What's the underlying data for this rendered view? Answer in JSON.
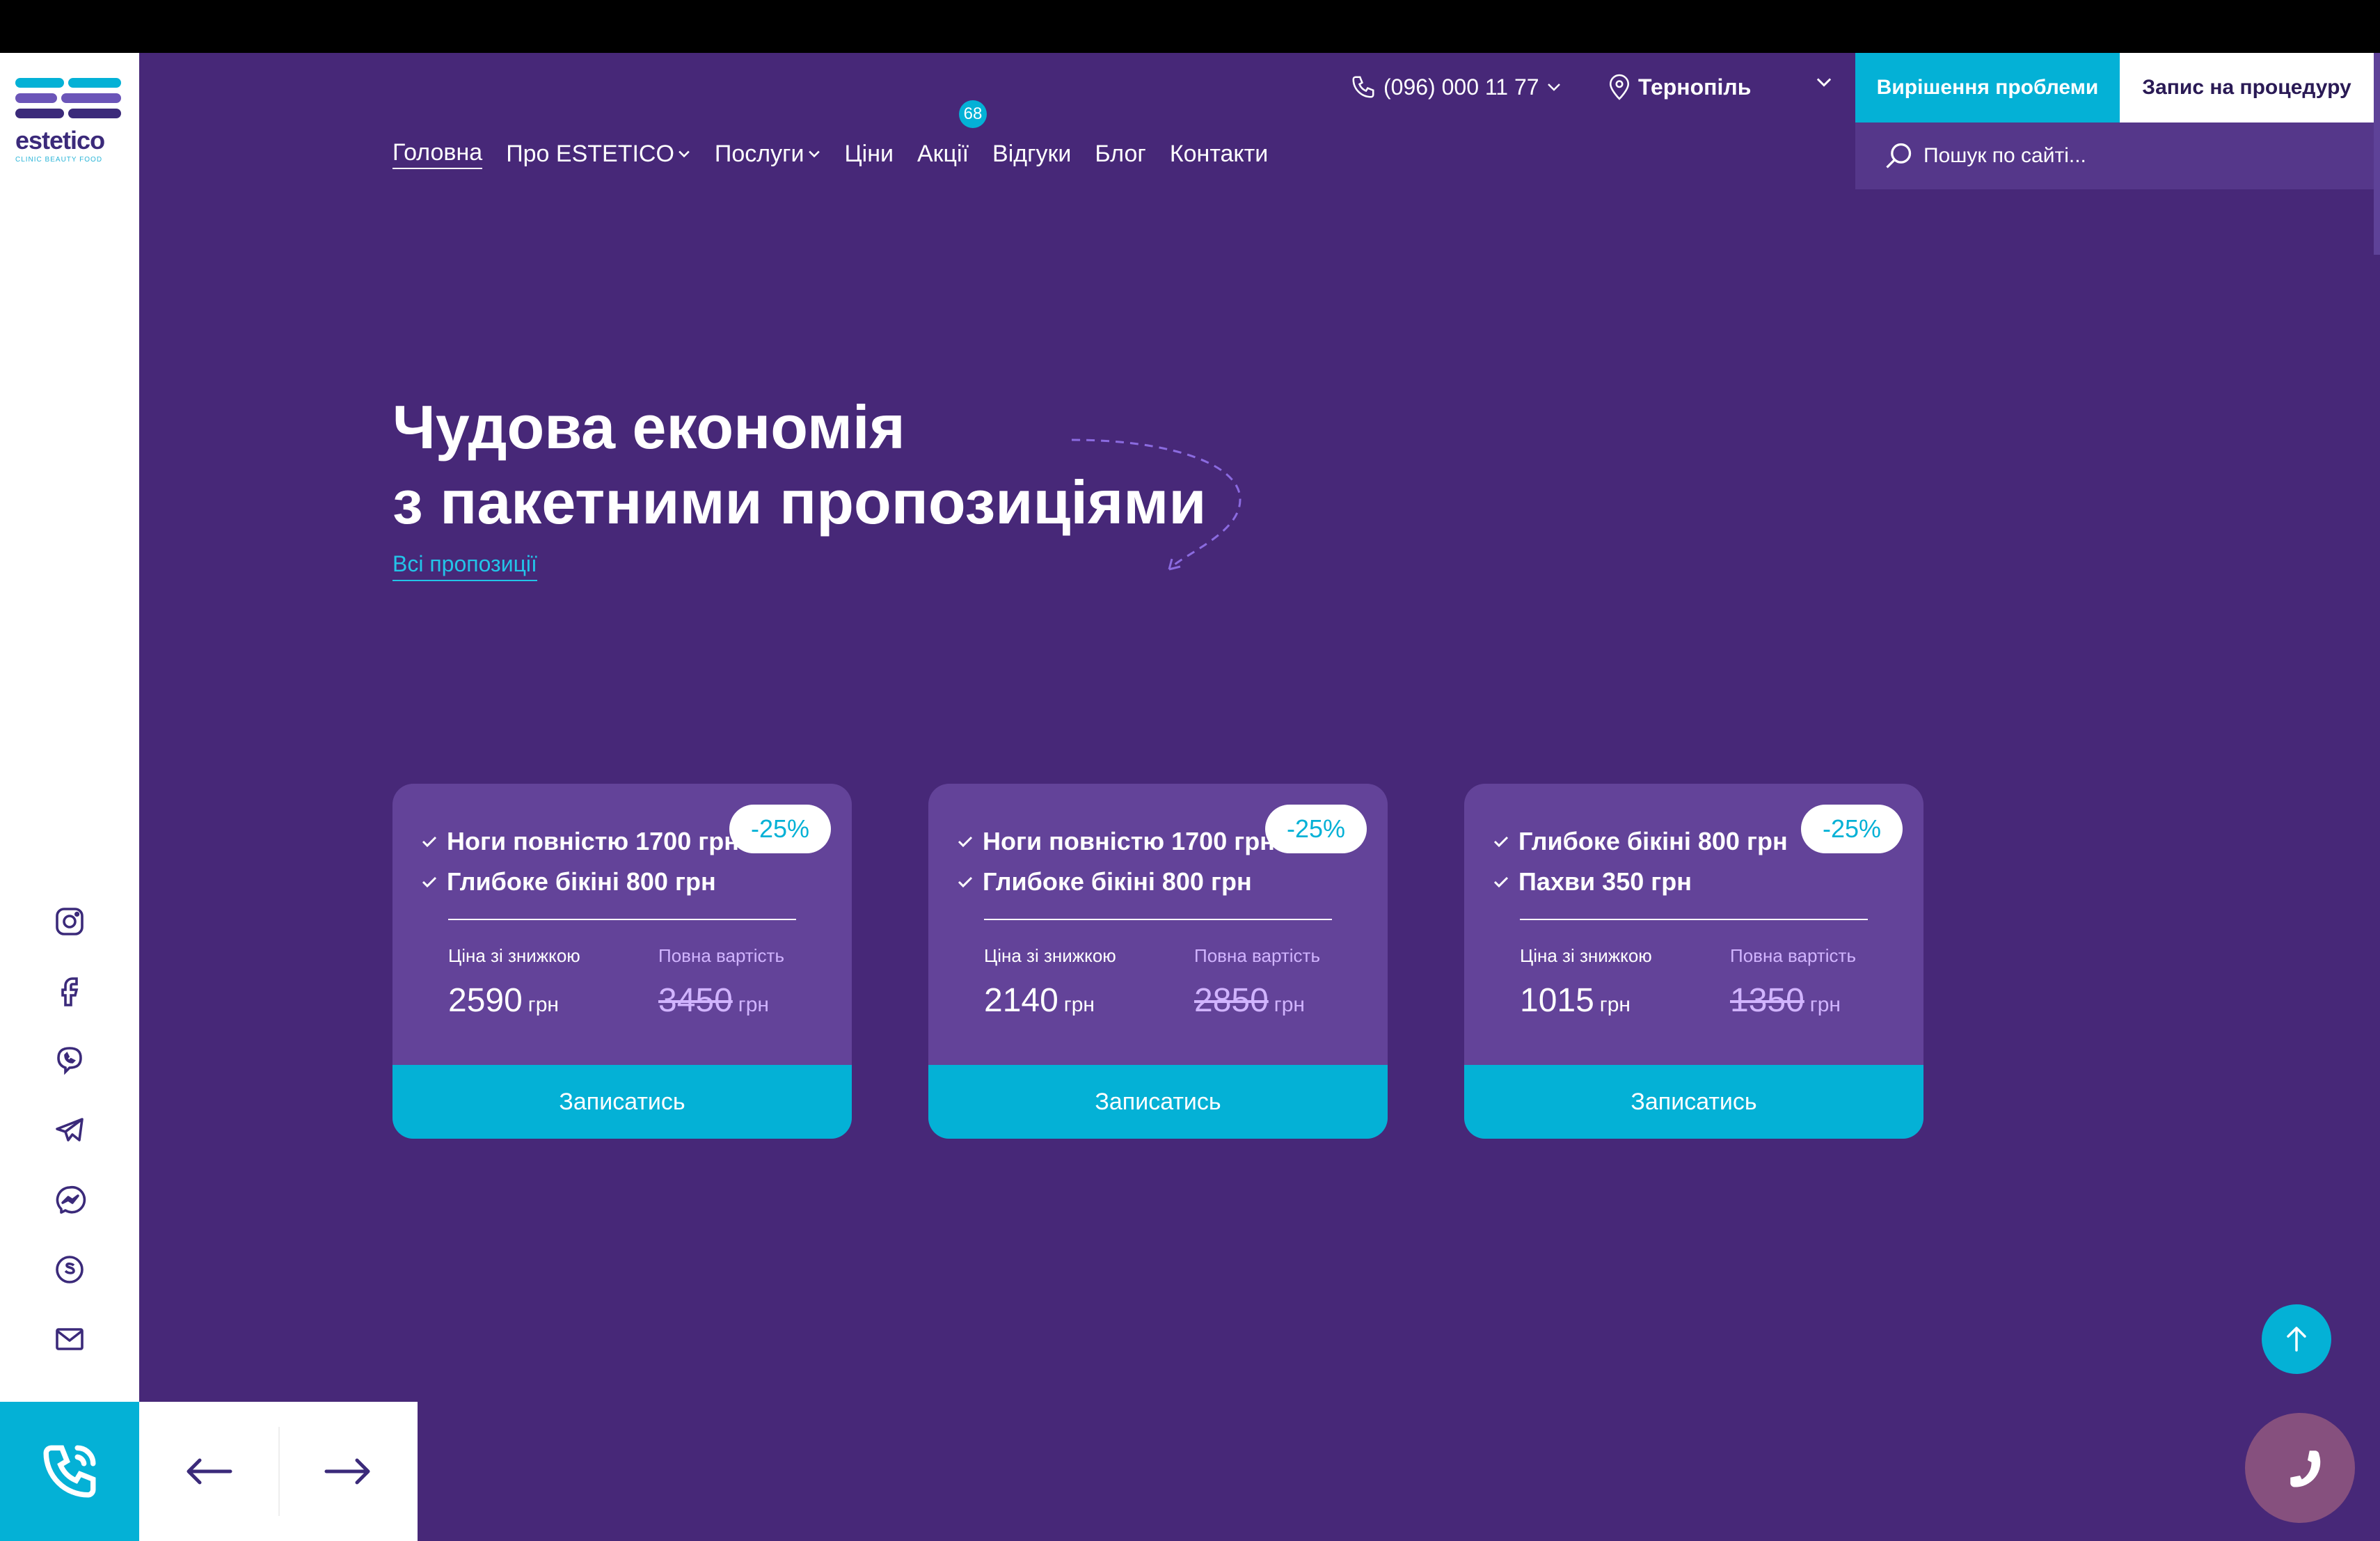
{
  "brand": {
    "name": "estetico",
    "tagline": "CLINIC BEAUTY FOOD",
    "colors": {
      "purple": "#472878",
      "cyan": "#04b1d6",
      "card": "#634399",
      "lavender": "#d1b4ff"
    }
  },
  "header": {
    "phone": "(096) 000 11 77",
    "city": "Тернопіль",
    "solve_button": "Вирішення проблеми",
    "book_button": "Запис на процедуру",
    "search_placeholder": "Пошук по сайті..."
  },
  "nav": {
    "items": [
      {
        "label": "Головна",
        "active": true
      },
      {
        "label": "Про ESTETICO",
        "dropdown": true
      },
      {
        "label": "Послуги",
        "dropdown": true
      },
      {
        "label": "Ціни"
      },
      {
        "label": "Акції",
        "badge": "68"
      },
      {
        "label": "Відгуки"
      },
      {
        "label": "Блог"
      },
      {
        "label": "Контакти"
      }
    ]
  },
  "hero": {
    "title_line1": "Чудова економія",
    "title_line2": "з пакетними пропозиціями",
    "link": "Всі пропозиції"
  },
  "cards": [
    {
      "items": [
        "Ноги повністю 1700 грн",
        "Глибоке бікіні 800 грн"
      ],
      "discount": "-25%",
      "price_label": "Ціна зі знижкою",
      "full_label": "Повна вартість",
      "price": "2590",
      "old_price": "3450",
      "currency": "грн",
      "cta": "Записатись"
    },
    {
      "items": [
        "Ноги повністю 1700 грн",
        "Глибоке бікіні 800 грн"
      ],
      "discount": "-25%",
      "price_label": "Ціна зі знижкою",
      "full_label": "Повна вартість",
      "price": "2140",
      "old_price": "2850",
      "currency": "грн",
      "cta": "Записатись"
    },
    {
      "items": [
        "Глибоке бікіні 800 грн",
        "Пахви 350 грн"
      ],
      "discount": "-25%",
      "price_label": "Ціна зі знижкою",
      "full_label": "Повна вартість",
      "price": "1015",
      "old_price": "1350",
      "currency": "грн",
      "cta": "Записатись"
    }
  ],
  "socials": [
    "instagram-icon",
    "facebook-icon",
    "viber-icon",
    "telegram-icon",
    "messenger-icon",
    "skype-icon",
    "mail-icon"
  ]
}
